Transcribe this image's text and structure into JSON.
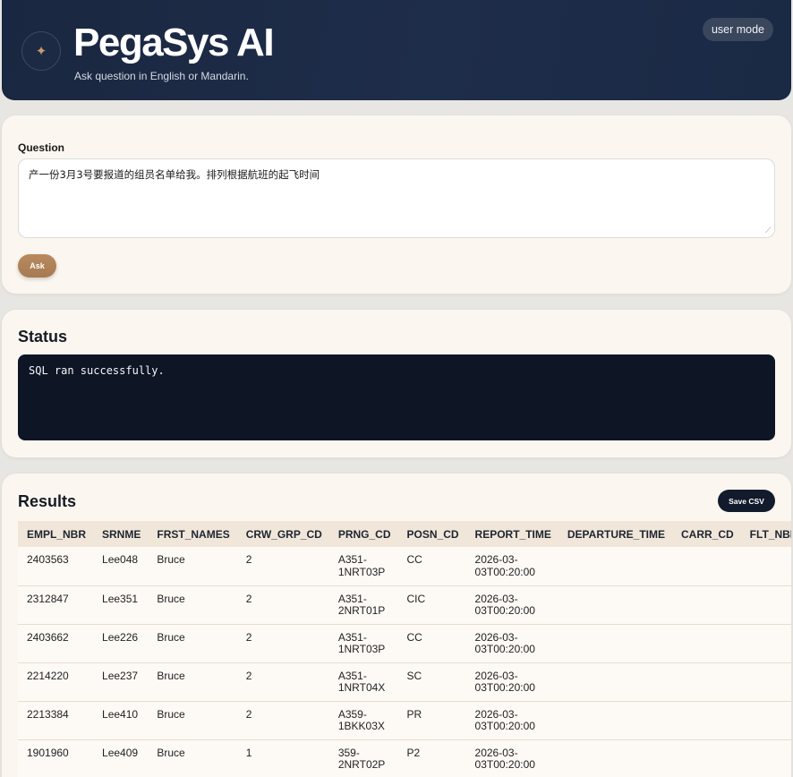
{
  "header": {
    "logo_icon": "sparkle-icon",
    "title": "PegaSys AI",
    "subtitle": "Ask question in English or Mandarin.",
    "mode_label": "user mode"
  },
  "question": {
    "label": "Question",
    "value": "产一份3月3号要报道的组员名单给我。排列根据航班的起飞时间",
    "ask_label": "Ask"
  },
  "status": {
    "title": "Status",
    "message": "SQL ran successfully."
  },
  "results": {
    "title": "Results",
    "save_label": "Save CSV",
    "columns": [
      "EMPL_NBR",
      "SRNME",
      "FRST_NAMES",
      "CRW_GRP_CD",
      "PRNG_CD",
      "POSN_CD",
      "REPORT_TIME",
      "DEPARTURE_TIME",
      "CARR_CD",
      "FLT_NBR"
    ],
    "rows": [
      [
        "2403563",
        "Lee048",
        "Bruce",
        "2",
        "A351-1NRT03P",
        "CC",
        "2026-03-03T00:20:00",
        "",
        "",
        ""
      ],
      [
        "2312847",
        "Lee351",
        "Bruce",
        "2",
        "A351-2NRT01P",
        "CIC",
        "2026-03-03T00:20:00",
        "",
        "",
        ""
      ],
      [
        "2403662",
        "Lee226",
        "Bruce",
        "2",
        "A351-1NRT03P",
        "CC",
        "2026-03-03T00:20:00",
        "",
        "",
        ""
      ],
      [
        "2214220",
        "Lee237",
        "Bruce",
        "2",
        "A351-1NRT04X",
        "SC",
        "2026-03-03T00:20:00",
        "",
        "",
        ""
      ],
      [
        "2213384",
        "Lee410",
        "Bruce",
        "2",
        "A359-1BKK03X",
        "PR",
        "2026-03-03T00:20:00",
        "",
        "",
        ""
      ],
      [
        "1901960",
        "Lee409",
        "Bruce",
        "1",
        "359-2NRT02P",
        "P2",
        "2026-03-03T00:20:00",
        "",
        "",
        ""
      ]
    ]
  }
}
